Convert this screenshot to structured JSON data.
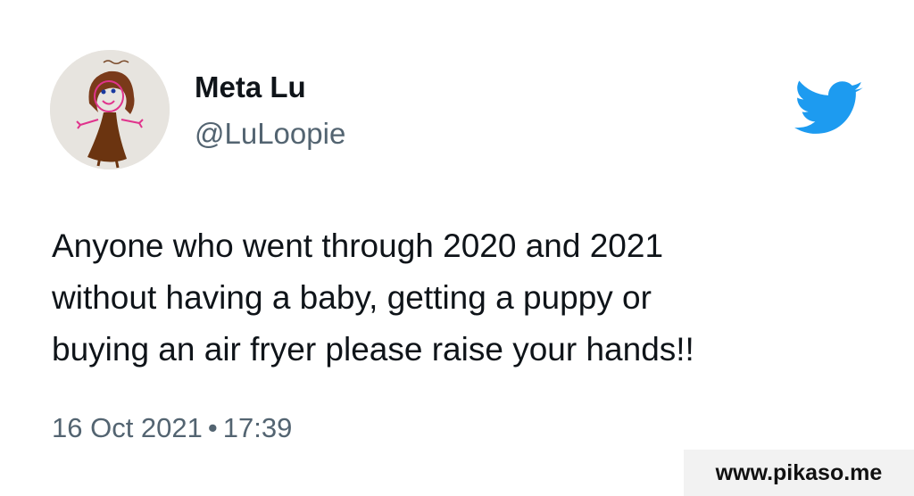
{
  "author": {
    "display_name": "Meta Lu",
    "handle": "@LuLoopie",
    "avatar_icon": "child-drawing-avatar"
  },
  "brand": {
    "icon": "twitter-bird-icon",
    "color": "#1d9bf0"
  },
  "tweet": {
    "lines": [
      "Anyone who went through 2020 and 2021",
      "without having a baby, getting a puppy or",
      "buying an air fryer please raise your hands!!"
    ]
  },
  "meta": {
    "date": "16 Oct 2021",
    "separator": "•",
    "time": "17:39"
  },
  "watermark": {
    "text": "www.pikaso.me"
  }
}
